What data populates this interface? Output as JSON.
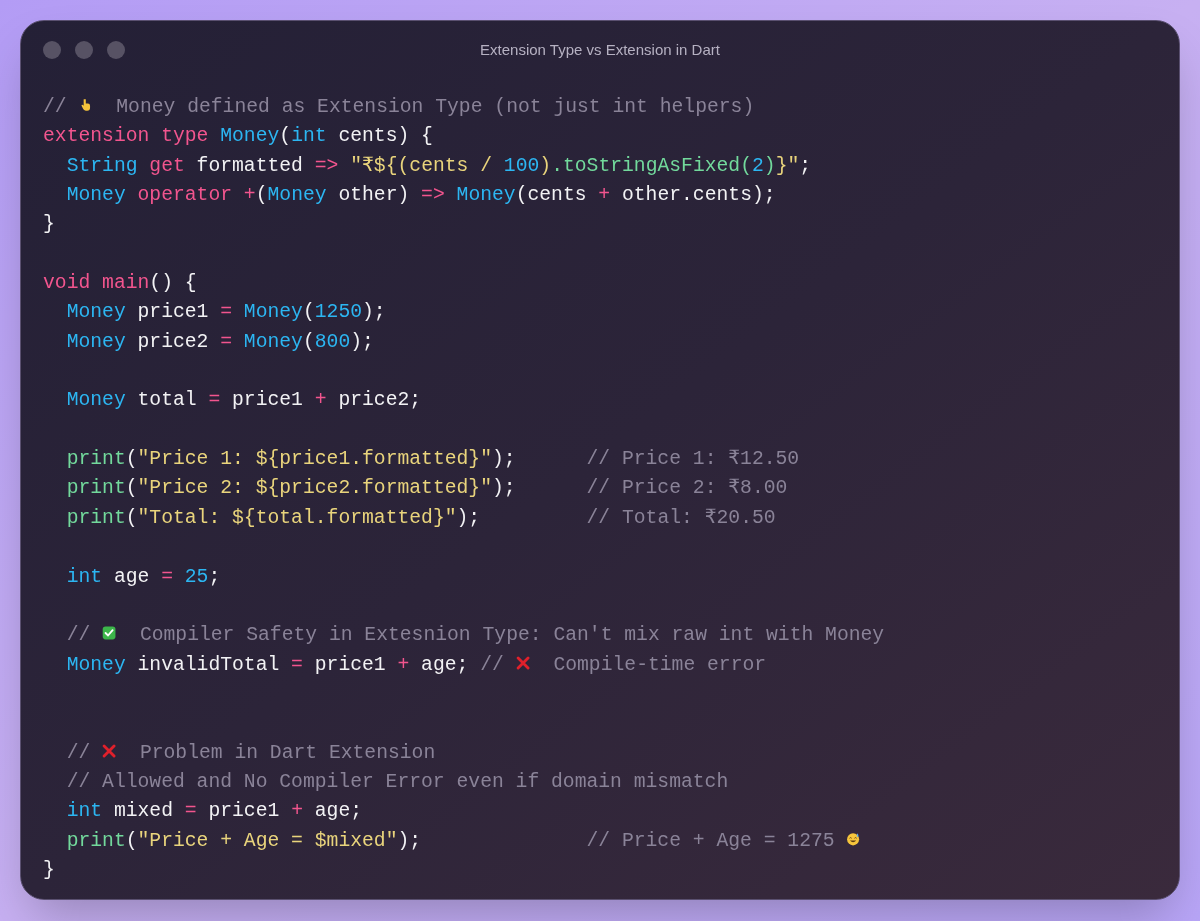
{
  "window": {
    "title": "Extension Type vs Extension in Dart"
  },
  "code": {
    "lines": [
      {
        "indented": false,
        "tokens": [
          {
            "text": "// ",
            "kind": "comment"
          },
          {
            "kind": "pointdown"
          },
          {
            "text": "  Money defined as Extension Type (not just int helpers)",
            "kind": "comment"
          }
        ]
      },
      {
        "indented": false,
        "tokens": [
          {
            "text": "extension type",
            "kind": "keyword"
          },
          {
            "text": " Money",
            "kind": "type"
          },
          {
            "text": "(",
            "kind": "plain"
          },
          {
            "text": "int",
            "kind": "type"
          },
          {
            "text": " cents) {",
            "kind": "plain"
          }
        ]
      },
      {
        "indented": true,
        "tokens": [
          {
            "text": "String",
            "kind": "type"
          },
          {
            "text": " get",
            "kind": "keyword"
          },
          {
            "text": " formatted ",
            "kind": "plain"
          },
          {
            "text": "=>",
            "kind": "op"
          },
          {
            "text": " \"₹${(cents / ",
            "kind": "string"
          },
          {
            "text": "100",
            "kind": "number"
          },
          {
            "text": ")",
            "kind": "string"
          },
          {
            "text": ".toStringAsFixed(",
            "kind": "function"
          },
          {
            "text": "2",
            "kind": "number"
          },
          {
            "text": ")",
            "kind": "function"
          },
          {
            "text": "}\"",
            "kind": "string"
          },
          {
            "text": ";",
            "kind": "plain"
          }
        ]
      },
      {
        "indented": true,
        "tokens": [
          {
            "text": "Money",
            "kind": "type"
          },
          {
            "text": " operator",
            "kind": "keyword"
          },
          {
            "text": " +",
            "kind": "op"
          },
          {
            "text": "(",
            "kind": "plain"
          },
          {
            "text": "Money",
            "kind": "type"
          },
          {
            "text": " other) ",
            "kind": "plain"
          },
          {
            "text": "=>",
            "kind": "op"
          },
          {
            "text": " Money",
            "kind": "type"
          },
          {
            "text": "(cents ",
            "kind": "plain"
          },
          {
            "text": "+",
            "kind": "op"
          },
          {
            "text": " other.cents);",
            "kind": "plain"
          }
        ]
      },
      {
        "indented": false,
        "tokens": [
          {
            "text": "}",
            "kind": "plain"
          }
        ]
      },
      {
        "kind": "blank"
      },
      {
        "indented": false,
        "tokens": [
          {
            "text": "void main",
            "kind": "keyword"
          },
          {
            "text": "() {",
            "kind": "plain"
          }
        ]
      },
      {
        "indented": true,
        "tokens": [
          {
            "text": "Money",
            "kind": "type"
          },
          {
            "text": " price1 ",
            "kind": "plain"
          },
          {
            "text": "=",
            "kind": "op"
          },
          {
            "text": " Money",
            "kind": "type"
          },
          {
            "text": "(",
            "kind": "plain"
          },
          {
            "text": "1250",
            "kind": "number"
          },
          {
            "text": ");",
            "kind": "plain"
          }
        ]
      },
      {
        "indented": true,
        "tokens": [
          {
            "text": "Money",
            "kind": "type"
          },
          {
            "text": " price2 ",
            "kind": "plain"
          },
          {
            "text": "=",
            "kind": "op"
          },
          {
            "text": " Money",
            "kind": "type"
          },
          {
            "text": "(",
            "kind": "plain"
          },
          {
            "text": "800",
            "kind": "number"
          },
          {
            "text": ");",
            "kind": "plain"
          }
        ]
      },
      {
        "kind": "blank"
      },
      {
        "indented": true,
        "tokens": [
          {
            "text": "Money",
            "kind": "type"
          },
          {
            "text": " total ",
            "kind": "plain"
          },
          {
            "text": "=",
            "kind": "op"
          },
          {
            "text": " price1 ",
            "kind": "plain"
          },
          {
            "text": "+",
            "kind": "op"
          },
          {
            "text": " price2;",
            "kind": "plain"
          }
        ]
      },
      {
        "kind": "blank"
      },
      {
        "indented": true,
        "tokens": [
          {
            "text": "print",
            "kind": "function"
          },
          {
            "text": "(",
            "kind": "plain"
          },
          {
            "text": "\"Price 1: ${price1.formatted}\"",
            "kind": "string"
          },
          {
            "text": ");",
            "kind": "plain"
          }
        ],
        "note": [
          {
            "text": "// Price 1: ₹12.50",
            "kind": "comment"
          }
        ]
      },
      {
        "indented": true,
        "tokens": [
          {
            "text": "print",
            "kind": "function"
          },
          {
            "text": "(",
            "kind": "plain"
          },
          {
            "text": "\"Price 2: ${price2.formatted}\"",
            "kind": "string"
          },
          {
            "text": ");",
            "kind": "plain"
          }
        ],
        "note": [
          {
            "text": "// Price 2: ₹8.00",
            "kind": "comment"
          }
        ]
      },
      {
        "indented": true,
        "tokens": [
          {
            "text": "print",
            "kind": "function"
          },
          {
            "text": "(",
            "kind": "plain"
          },
          {
            "text": "\"Total: ${total.formatted}\"",
            "kind": "string"
          },
          {
            "text": ");",
            "kind": "plain"
          }
        ],
        "note": [
          {
            "text": "// Total: ₹20.50",
            "kind": "comment"
          }
        ]
      },
      {
        "kind": "blank"
      },
      {
        "indented": true,
        "tokens": [
          {
            "text": "int",
            "kind": "type"
          },
          {
            "text": " age ",
            "kind": "plain"
          },
          {
            "text": "=",
            "kind": "op"
          },
          {
            "text": " 25",
            "kind": "number"
          },
          {
            "text": ";",
            "kind": "plain"
          }
        ]
      },
      {
        "kind": "blank"
      },
      {
        "indented": true,
        "tokens": [
          {
            "text": "// ",
            "kind": "comment"
          },
          {
            "kind": "checkmark"
          },
          {
            "text": "  Compiler Safety in Extesnion Type: Can't mix raw int with Money",
            "kind": "comment"
          }
        ]
      },
      {
        "indented": true,
        "tokens": [
          {
            "text": "Money",
            "kind": "type"
          },
          {
            "text": " invalidTotal ",
            "kind": "plain"
          },
          {
            "text": "=",
            "kind": "op"
          },
          {
            "text": " price1 ",
            "kind": "plain"
          },
          {
            "text": "+",
            "kind": "op"
          },
          {
            "text": " age; ",
            "kind": "plain"
          },
          {
            "text": "// ",
            "kind": "comment"
          },
          {
            "kind": "cross"
          },
          {
            "text": "  Compile-time error",
            "kind": "comment"
          }
        ]
      },
      {
        "kind": "blank"
      },
      {
        "kind": "blank"
      },
      {
        "indented": true,
        "tokens": [
          {
            "text": "// ",
            "kind": "comment"
          },
          {
            "kind": "cross"
          },
          {
            "text": "  Problem in Dart Extension",
            "kind": "comment"
          }
        ]
      },
      {
        "indented": true,
        "tokens": [
          {
            "text": "// Allowed and No Compiler Error even if domain mismatch",
            "kind": "comment"
          }
        ]
      },
      {
        "indented": true,
        "tokens": [
          {
            "text": "int",
            "kind": "type"
          },
          {
            "text": " mixed ",
            "kind": "plain"
          },
          {
            "text": "=",
            "kind": "op"
          },
          {
            "text": " price1 ",
            "kind": "plain"
          },
          {
            "text": "+",
            "kind": "op"
          },
          {
            "text": " age;",
            "kind": "plain"
          }
        ]
      },
      {
        "indented": true,
        "tokens": [
          {
            "text": "print",
            "kind": "function"
          },
          {
            "text": "(",
            "kind": "plain"
          },
          {
            "text": "\"Price + Age = $mixed\"",
            "kind": "string"
          },
          {
            "text": ");",
            "kind": "plain"
          }
        ],
        "note": [
          {
            "text": "// Price + Age = 1275 ",
            "kind": "comment"
          },
          {
            "kind": "sweatsmile"
          }
        ]
      },
      {
        "indented": false,
        "tokens": [
          {
            "text": "}",
            "kind": "plain"
          }
        ]
      }
    ]
  }
}
